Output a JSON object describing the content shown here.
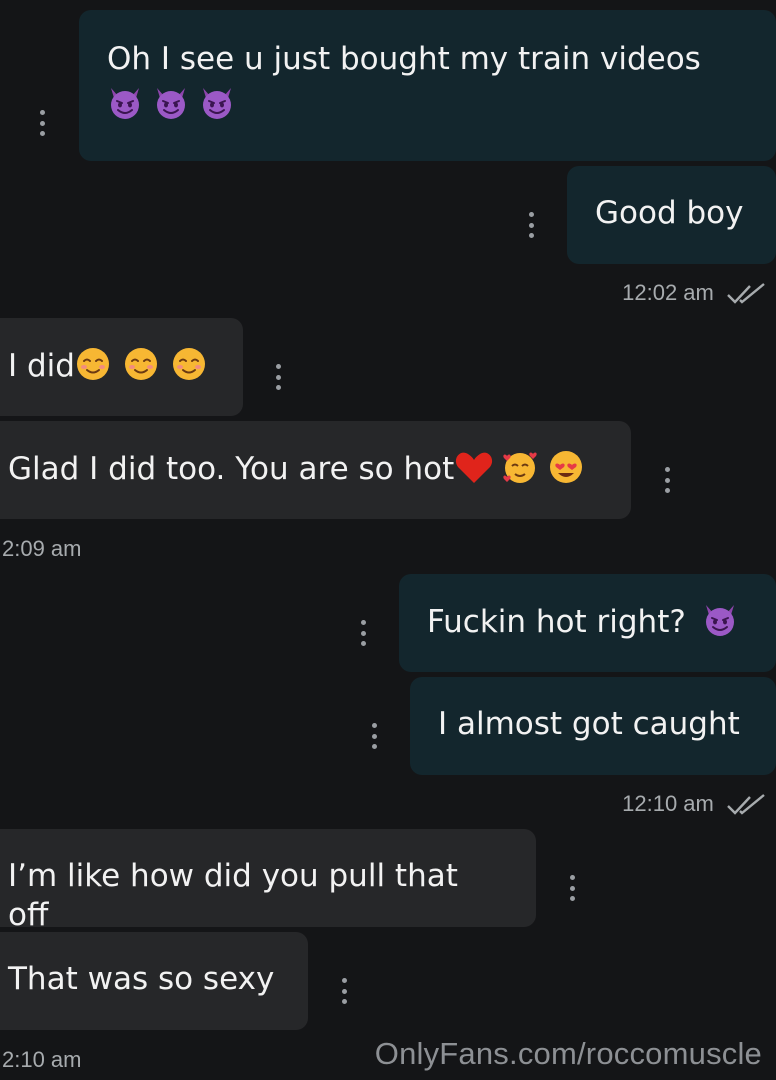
{
  "messages": [
    {
      "dir": "out",
      "text": "Oh I see u just bought my train videos",
      "emoji": [
        "smiling-devil",
        "smiling-devil",
        "smiling-devil"
      ]
    },
    {
      "dir": "out",
      "text": "Good boy"
    },
    {
      "dir": "in",
      "text": "I did",
      "emoji": [
        "smiling-face",
        "smiling-face",
        "smiling-face"
      ]
    },
    {
      "dir": "in",
      "text": "Glad I did too. You are so hot",
      "emoji": [
        "red-heart",
        "smiling-face-with-hearts",
        "heart-eyes"
      ]
    },
    {
      "dir": "out",
      "text": "Fuckin hot right?",
      "emoji": [
        "smiling-devil"
      ]
    },
    {
      "dir": "out",
      "text": "I almost got caught"
    },
    {
      "dir": "in",
      "text": "I’m like how did you pull that off"
    },
    {
      "dir": "in",
      "text": "That was so sexy"
    }
  ],
  "timestamps": [
    "12:02 am",
    "2:09 am",
    "12:10 am",
    "2:10 am"
  ],
  "watermark": "OnlyFans.com/roccomuscle",
  "colors": {
    "background": "#141517",
    "outgoing": "#13262d",
    "incoming": "#262729"
  }
}
